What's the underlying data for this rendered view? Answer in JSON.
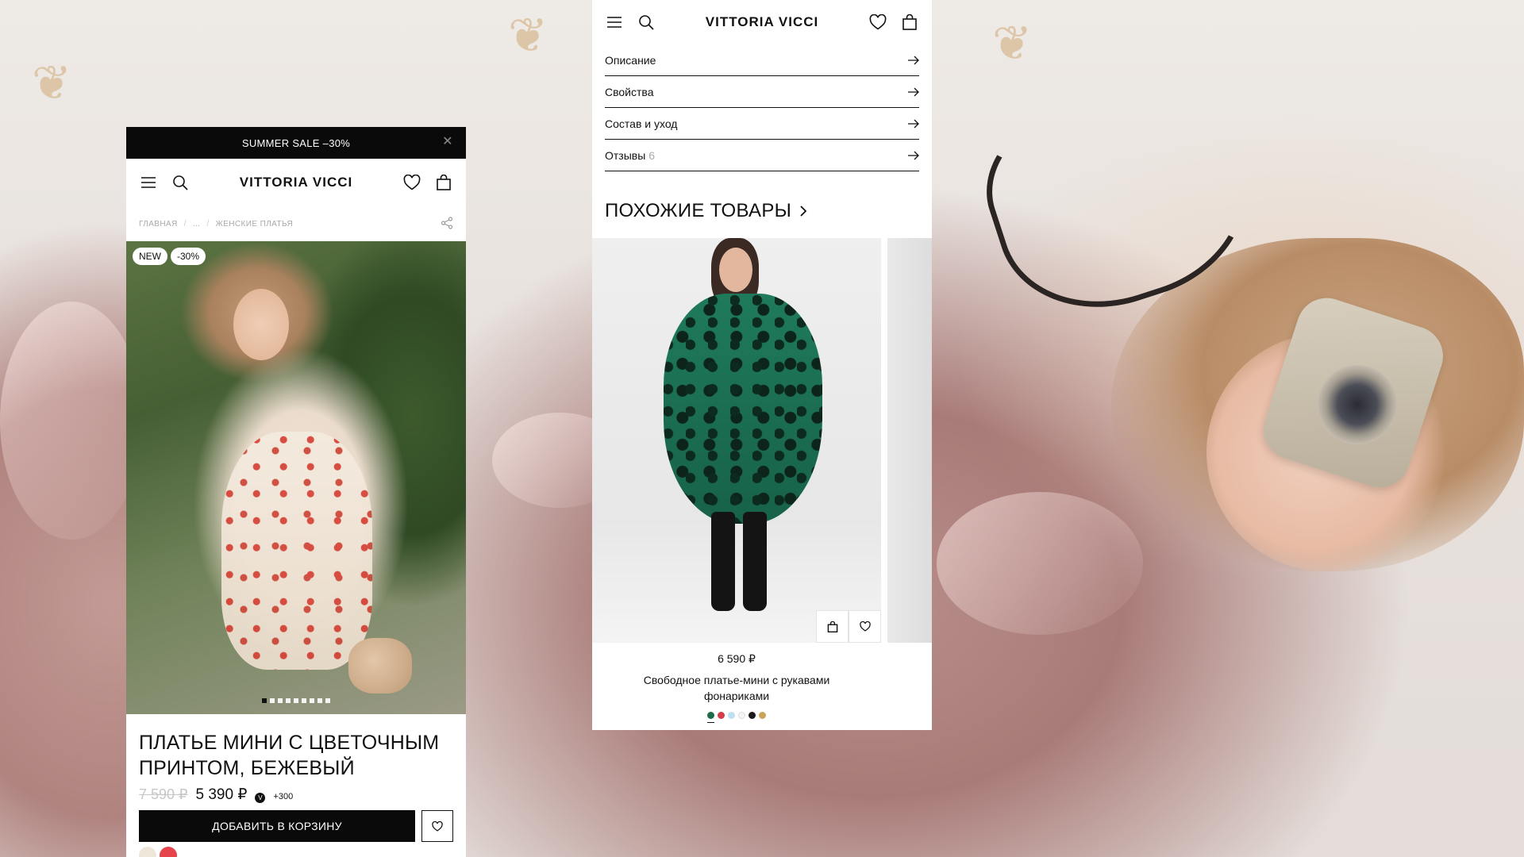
{
  "brand": "VITTORIA VICCI",
  "product_page": {
    "promo_text": "SUMMER SALE –30%",
    "breadcrumb": [
      "ГЛАВНАЯ",
      "...",
      "ЖЕНСКИЕ ПЛАТЬЯ"
    ],
    "badges": [
      "NEW",
      "-30%"
    ],
    "gallery": {
      "slides": 9,
      "active_index": 0
    },
    "title": "ПЛАТЬЕ МИНИ С ЦВЕТОЧНЫМ ПРИНТОМ, БЕЖЕВЫЙ",
    "old_price": "7 590 ₽",
    "price": "5 390 ₽",
    "bonus": "+300",
    "add_to_cart_label": "ДОБАВИТЬ В КОРЗИНУ",
    "swatch_colors": [
      "#efe6da",
      "#e4444a"
    ]
  },
  "details_page": {
    "accordion": [
      {
        "label": "Описание",
        "count": ""
      },
      {
        "label": "Свойства",
        "count": ""
      },
      {
        "label": "Состав и уход",
        "count": ""
      },
      {
        "label": "Отзывы",
        "count": "6"
      }
    ],
    "similar_title": "ПОХОЖИЕ ТОВАРЫ",
    "similar_items": [
      {
        "price": "6 590 ₽",
        "name": "Свободное платье-мини с рукавами фонариками",
        "swatch_colors": [
          "#1c6b4a",
          "#d43d4c",
          "#bfe0f2",
          "#f5f5f5",
          "#1b1b1b",
          "#c9a55c"
        ]
      }
    ]
  },
  "icons": [
    "menu-icon",
    "search-icon",
    "heart-icon",
    "bag-icon",
    "close-icon",
    "share-icon",
    "arrow-right-icon",
    "chevron-right-icon"
  ],
  "colors": {
    "accent": "#0a0a0a",
    "muted": "#a9a9a9",
    "background": "#ffffff"
  }
}
